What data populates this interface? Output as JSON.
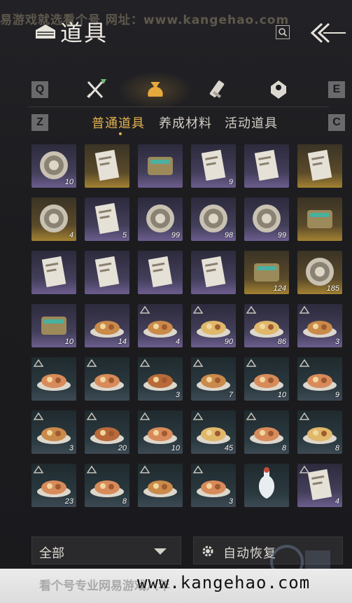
{
  "watermark_top": "易游戏就选看个号   网址：www.kangehao.com",
  "header": {
    "title": "道具"
  },
  "category_keys": {
    "prev": "Q",
    "next": "E"
  },
  "categories": [
    {
      "icon": "crossed-swords-icon",
      "active": false
    },
    {
      "icon": "pouch-icon",
      "active": true
    },
    {
      "icon": "scroll-icon",
      "active": false
    },
    {
      "icon": "gem-icon",
      "active": false
    }
  ],
  "subtab_keys": {
    "prev": "Z",
    "next": "C"
  },
  "subtabs": [
    {
      "label": "普通道具",
      "active": true
    },
    {
      "label": "养成材料",
      "active": false
    },
    {
      "label": "活动道具",
      "active": false
    }
  ],
  "items": [
    {
      "icon": "mountain-token-icon",
      "rarity": "purple",
      "count": "10"
    },
    {
      "icon": "paper-bundle-icon",
      "rarity": "gold",
      "count": ""
    },
    {
      "icon": "gift-box-icon",
      "rarity": "purple",
      "count": ""
    },
    {
      "icon": "scroll-map-icon",
      "rarity": "purple",
      "count": "9"
    },
    {
      "icon": "painting-icon",
      "rarity": "purple",
      "count": ""
    },
    {
      "icon": "open-book-icon",
      "rarity": "gold",
      "count": ""
    },
    {
      "icon": "silver-pendant-icon",
      "rarity": "gold",
      "count": "4"
    },
    {
      "icon": "red-envelope-letter-icon",
      "rarity": "purple",
      "count": "5"
    },
    {
      "icon": "bird-medal-icon",
      "rarity": "purple",
      "count": "99"
    },
    {
      "icon": "bird-medal-icon",
      "rarity": "purple",
      "count": "98"
    },
    {
      "icon": "bird-medal-icon",
      "rarity": "purple",
      "count": "99"
    },
    {
      "icon": "gold-powder-icon",
      "rarity": "gold",
      "count": ""
    },
    {
      "icon": "animal-card-icon",
      "rarity": "purple",
      "count": ""
    },
    {
      "icon": "animal-card-icon",
      "rarity": "purple",
      "count": ""
    },
    {
      "icon": "animal-card-icon",
      "rarity": "purple",
      "count": ""
    },
    {
      "icon": "animal-card-icon",
      "rarity": "purple",
      "count": ""
    },
    {
      "icon": "bronze-bell-icon",
      "rarity": "gold",
      "count": "124"
    },
    {
      "icon": "cat-coin-icon",
      "rarity": "gold",
      "count": "185"
    },
    {
      "icon": "jade-stone-icon",
      "rarity": "purple",
      "count": "10"
    },
    {
      "icon": "dumplings-plate-icon",
      "rarity": "purple",
      "count": "14"
    },
    {
      "icon": "fried-snack-icon",
      "rarity": "purple",
      "count": "4",
      "badge": true
    },
    {
      "icon": "stew-pot-icon",
      "rarity": "purple",
      "count": "90",
      "badge": true
    },
    {
      "icon": "steamed-buns-icon",
      "rarity": "purple",
      "count": "86",
      "badge": true
    },
    {
      "icon": "sliced-meat-icon",
      "rarity": "purple",
      "count": "3",
      "badge": true
    },
    {
      "icon": "pork-dish-icon",
      "rarity": "teal",
      "count": "",
      "badge": true
    },
    {
      "icon": "braised-cubes-icon",
      "rarity": "teal",
      "count": "",
      "badge": true
    },
    {
      "icon": "fish-plate-icon",
      "rarity": "teal",
      "count": "3",
      "badge": true
    },
    {
      "icon": "noodle-bowl-icon",
      "rarity": "teal",
      "count": "7",
      "badge": true
    },
    {
      "icon": "soup-bowl-icon",
      "rarity": "teal",
      "count": "10",
      "badge": true
    },
    {
      "icon": "rice-bowl-icon",
      "rarity": "teal",
      "count": "9",
      "badge": true
    },
    {
      "icon": "greens-bowl-icon",
      "rarity": "teal",
      "count": "3",
      "badge": true
    },
    {
      "icon": "broth-bowl-icon",
      "rarity": "teal",
      "count": "20",
      "badge": true
    },
    {
      "icon": "meat-bowl-icon",
      "rarity": "teal",
      "count": "10",
      "badge": true
    },
    {
      "icon": "noodle-plate-icon",
      "rarity": "teal",
      "count": "45",
      "badge": true
    },
    {
      "icon": "fried-noodles-icon",
      "rarity": "teal",
      "count": "8",
      "badge": true
    },
    {
      "icon": "clay-pot-icon",
      "rarity": "teal",
      "count": "8",
      "badge": true
    },
    {
      "icon": "pork-dish-icon",
      "rarity": "teal",
      "count": "23",
      "badge": true
    },
    {
      "icon": "braised-cubes-icon",
      "rarity": "teal",
      "count": "8",
      "badge": true
    },
    {
      "icon": "fried-snack-icon",
      "rarity": "teal",
      "count": "",
      "badge": true
    },
    {
      "icon": "drumstick-icon",
      "rarity": "teal",
      "count": "3",
      "badge": true
    },
    {
      "icon": "white-vase-icon",
      "rarity": "teal",
      "count": ""
    },
    {
      "icon": "note-paper-icon",
      "rarity": "purple",
      "count": "4",
      "badge": true
    }
  ],
  "filter": {
    "label": "全部"
  },
  "auto_restore": {
    "label": "自动恢复"
  },
  "banner": {
    "left_text": "看个号专业网易游戏八年 ",
    "url": "www.kangehao.com"
  },
  "colors": {
    "accent_gold": "#e3b24e",
    "rarity_gold": "#a48232",
    "rarity_purple": "#6c5d8e",
    "rarity_teal": "#3d4a55"
  }
}
